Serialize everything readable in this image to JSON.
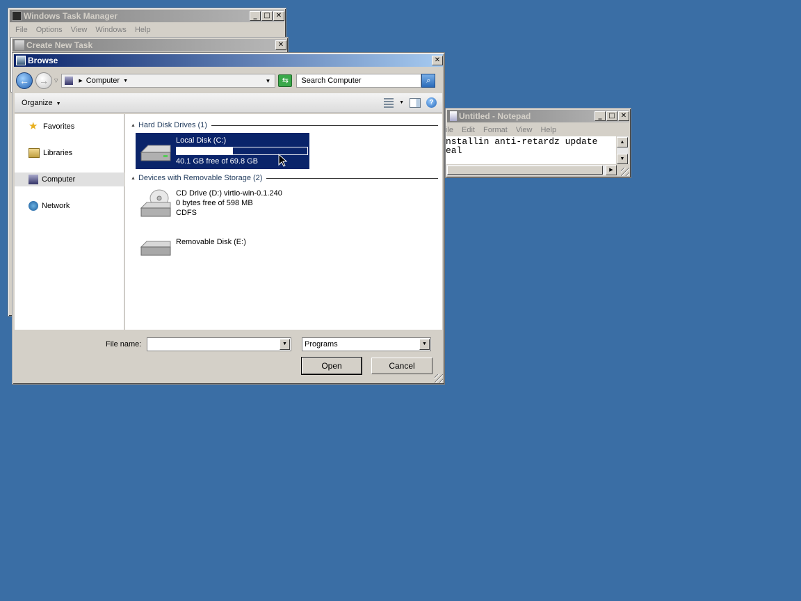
{
  "taskmgr": {
    "title": "Windows Task Manager",
    "menu": [
      "File",
      "Options",
      "View",
      "Windows",
      "Help"
    ]
  },
  "createtask": {
    "title": "Create New Task"
  },
  "browse": {
    "title": "Browse",
    "address": "Computer",
    "search_placeholder": "Search Computer",
    "organize_label": "Organize",
    "nav": [
      {
        "label": "Favorites"
      },
      {
        "label": "Libraries"
      },
      {
        "label": "Computer"
      },
      {
        "label": "Network"
      }
    ],
    "groups": {
      "hdd": "Hard Disk Drives (1)",
      "removable": "Devices with Removable Storage (2)"
    },
    "drives": {
      "c": {
        "name": "Local Disk (C:)",
        "free": "40.1 GB free of 69.8 GB",
        "used_fraction": 0.43
      },
      "d": {
        "name": "CD Drive (D:) virtio-win-0.1.240",
        "free": "0 bytes free of 598 MB",
        "fs": "CDFS"
      },
      "e": {
        "name": "Removable Disk (E:)"
      }
    },
    "filename_label": "File name:",
    "filename_value": "",
    "filter_value": "Programs",
    "open_label": "Open",
    "cancel_label": "Cancel"
  },
  "notepad": {
    "title": "Untitled - Notepad",
    "menu": [
      "ile",
      "Edit",
      "Format",
      "View",
      "Help"
    ],
    "text": "nstallin anti-retardz update\neal"
  },
  "colors": {
    "desktop": "#3a6ea5",
    "selection": "#0a246a"
  }
}
